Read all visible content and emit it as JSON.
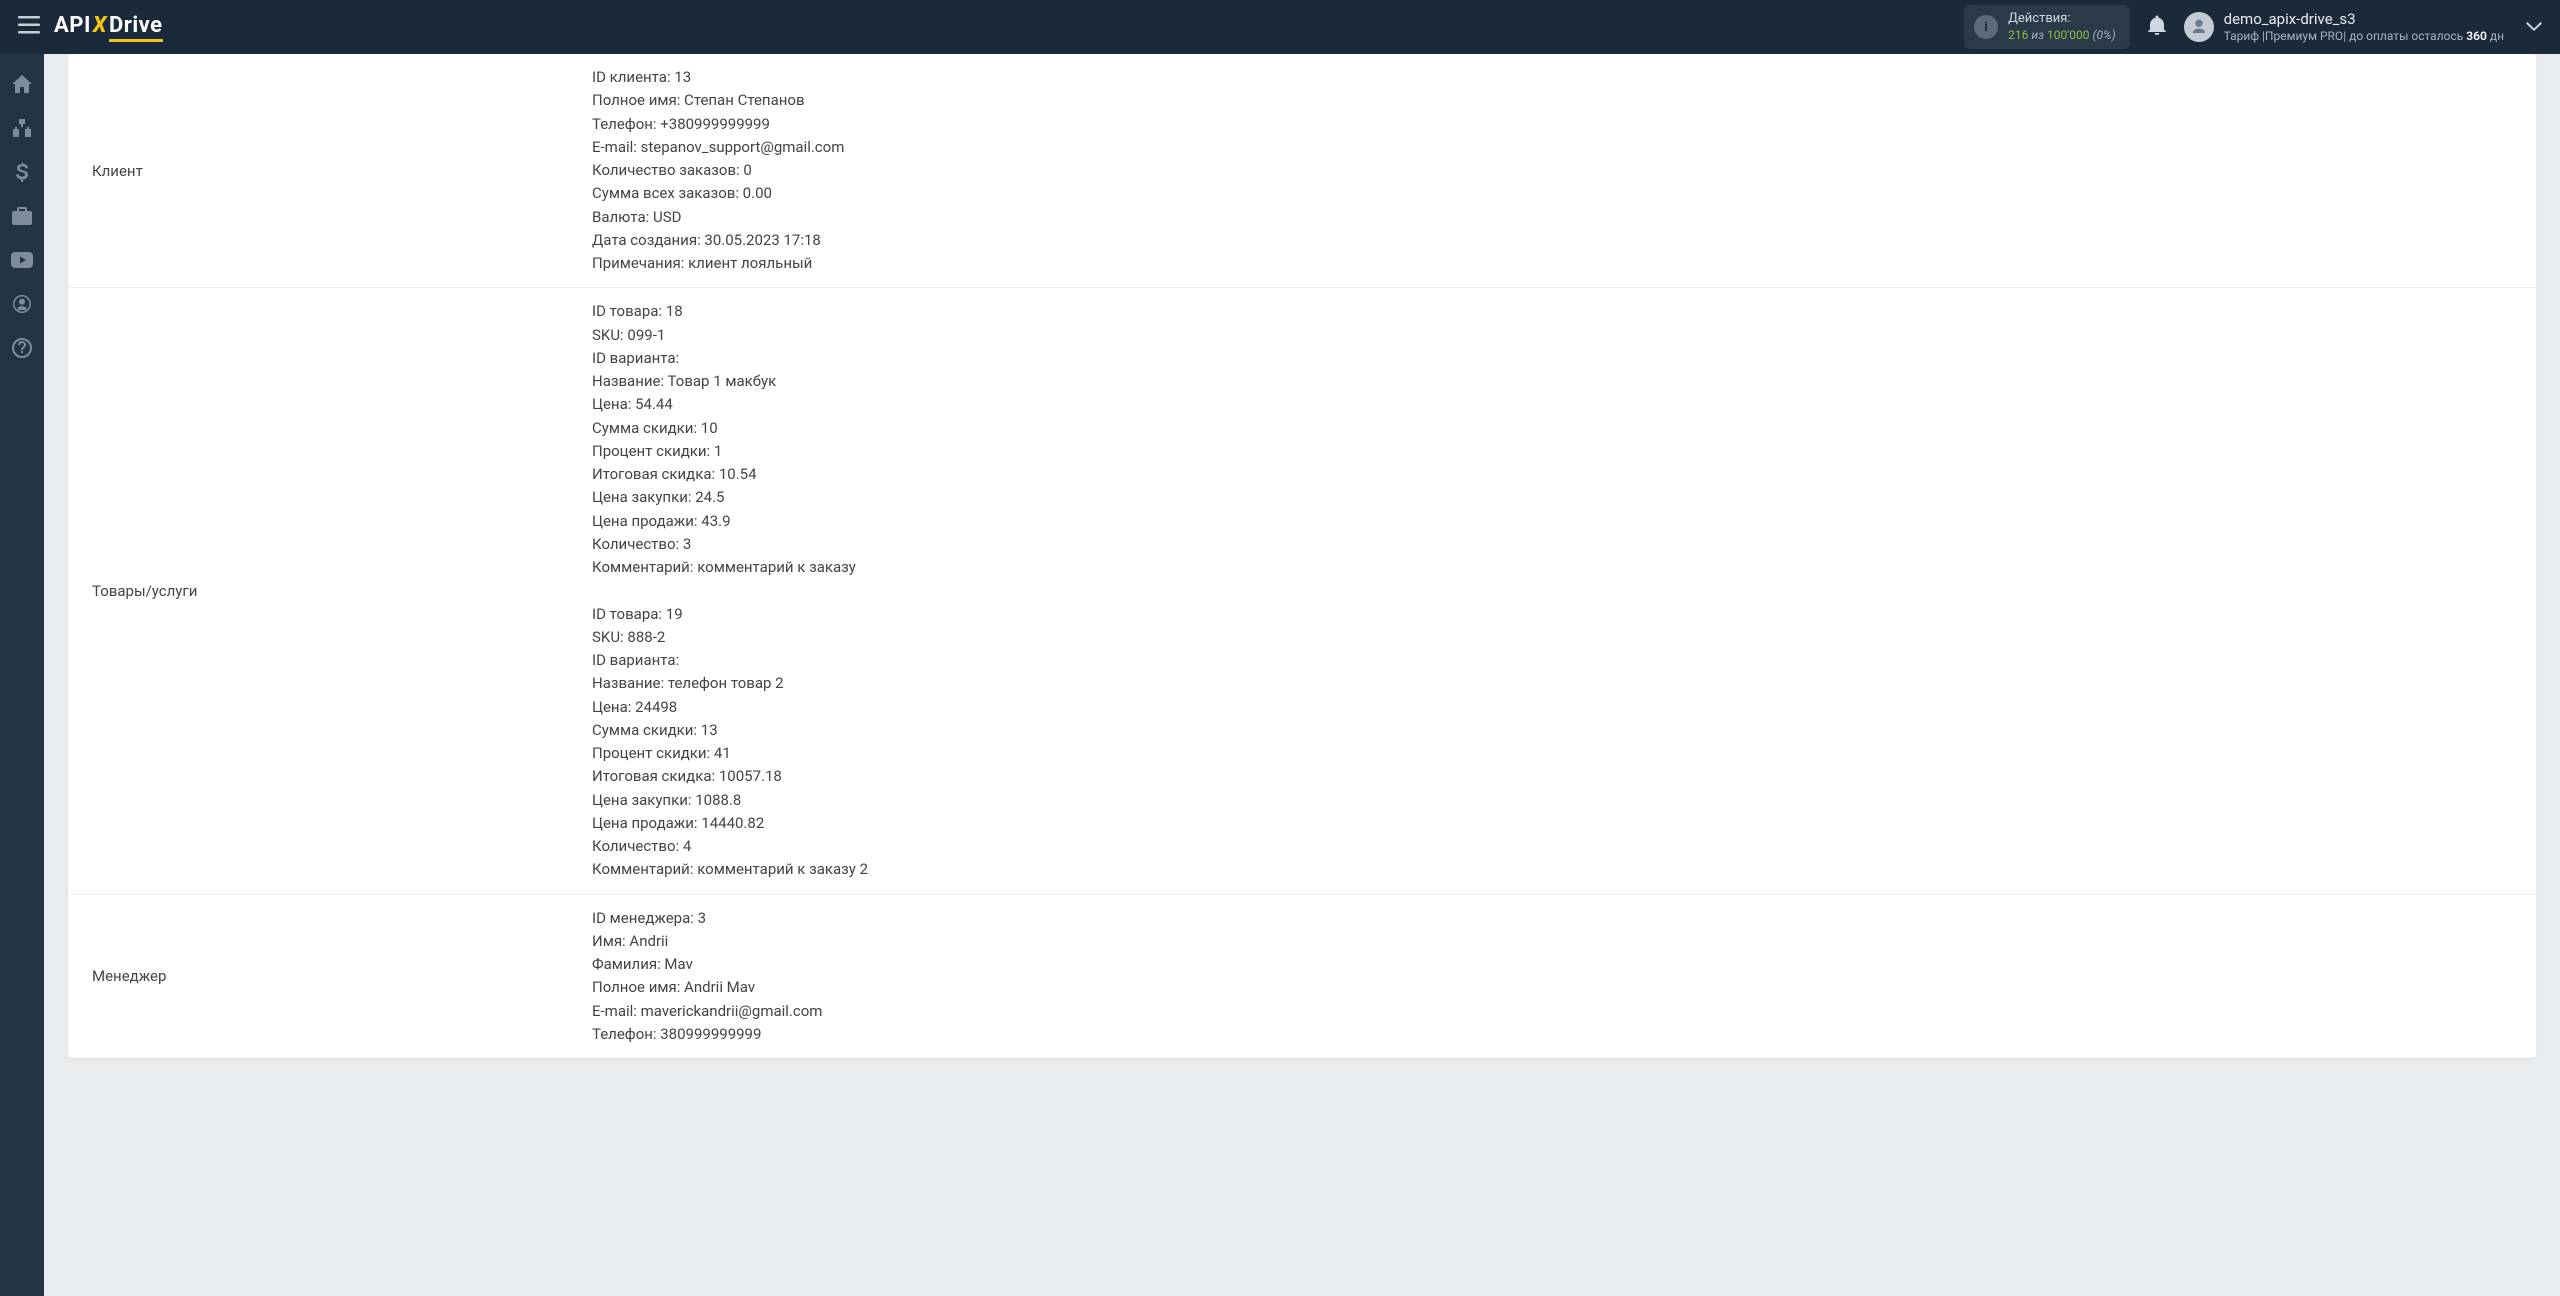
{
  "header": {
    "actions_label": "Действия:",
    "actions_count": "216",
    "actions_iz": "из",
    "actions_total": "100'000",
    "actions_pct": "(0%)",
    "username": "demo_apix-drive_s3",
    "tariff_prefix": "Тариф |Премиум PRO| до оплаты осталось",
    "tariff_days": "360",
    "tariff_suffix": "дн"
  },
  "rows": {
    "client": {
      "label": "Клиент",
      "text": "ID клиента: 13\nПолное имя: Степан Степанов\nТелефон: +380999999999\nE-mail: stepanov_support@gmail.com\nКоличество заказов: 0\nСумма всех заказов: 0.00\nВалюта: USD\nДата создания: 30.05.2023 17:18\nПримечания: клиент лояльный"
    },
    "goods": {
      "label": "Товары/услуги",
      "text": "ID товара: 18\nSKU: 099-1\nID варианта:\nНазвание: Товар 1 макбук\nЦена: 54.44\nСумма скидки: 10\nПроцент скидки: 1\nИтоговая скидка: 10.54\nЦена закупки: 24.5\nЦена продажи: 43.9\nКоличество: 3\nКомментарий: комментарий к заказу\n\nID товара: 19\nSKU: 888-2\nID варианта:\nНазвание: телефон товар 2\nЦена: 24498\nСумма скидки: 13\nПроцент скидки: 41\nИтоговая скидка: 10057.18\nЦена закупки: 1088.8\nЦена продажи: 14440.82\nКоличество: 4\nКомментарий: комментарий к заказу 2"
    },
    "manager": {
      "label": "Менеджер",
      "text": "ID менеджера: 3\nИмя: Andrii\nФамилия: Mav\nПолное имя: Andrii Mav\nE-mail: maverickandrii@gmail.com\nТелефон: 380999999999"
    }
  }
}
